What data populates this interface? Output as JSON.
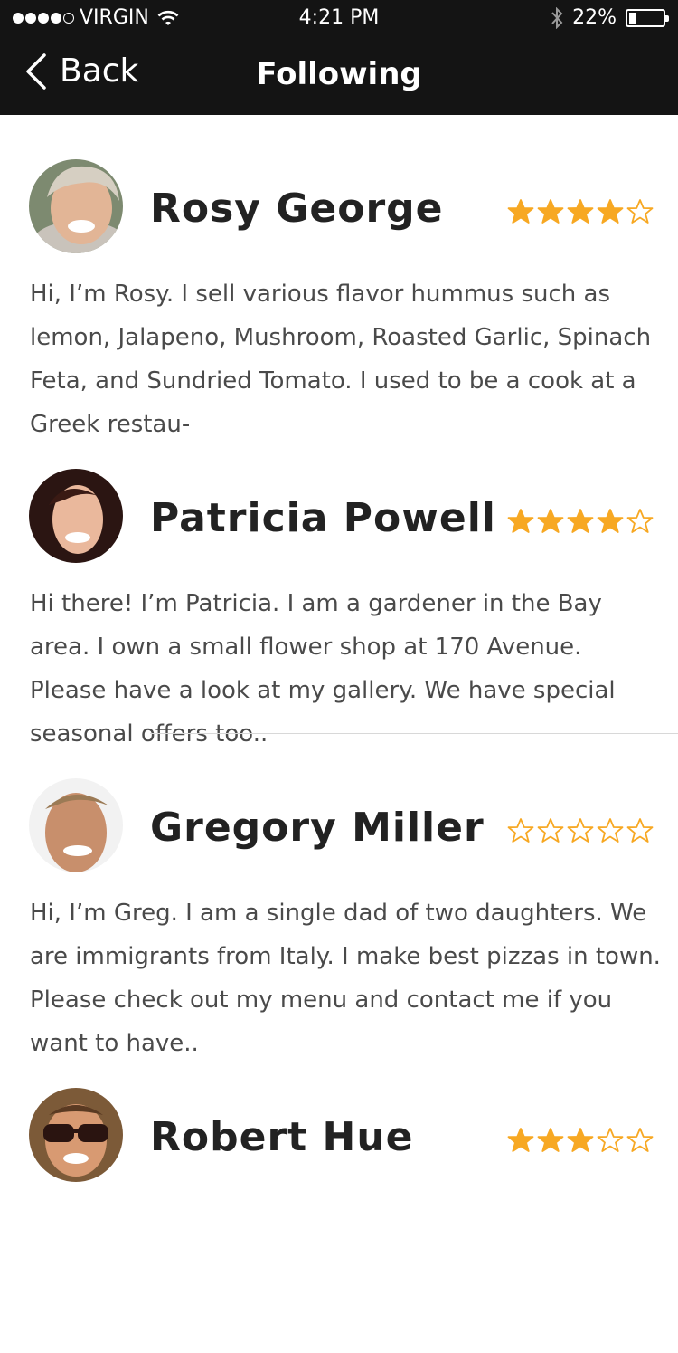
{
  "status_bar": {
    "carrier": "VIRGIN",
    "time": "4:21 PM",
    "battery": "22%",
    "signal_bars": 4,
    "battery_level": 0.22
  },
  "nav": {
    "back_label": "Back",
    "title": "Following"
  },
  "colors": {
    "bar": "#141414",
    "star": "#f7a823",
    "text": "#2b2b2b",
    "divider": "#d8d8d8"
  },
  "users": [
    {
      "name": "Rosy George",
      "rating": 4,
      "bio": "Hi, I’m Rosy. I sell various flavor hummus such as lemon, Jalapeno, Mushroom, Roasted Garlic, Spinach Feta, and Sundried Tomato. I used to be a cook at a Greek restau-"
    },
    {
      "name": "Patricia Powell",
      "rating": 4,
      "bio": "Hi there! I’m Patricia. I am a gardener in the Bay area. I own a small flower shop at 170 Avenue. Please have a look at my gallery. We have special seasonal offers too.."
    },
    {
      "name": "Gregory Miller",
      "rating": 0,
      "bio": "Hi, I’m Greg. I am a single dad of two daughters. We are immigrants from Italy. I make best pizzas in town. Please check out my menu and contact me if you want to have.."
    },
    {
      "name": "Robert Hue",
      "rating": 3,
      "bio": ""
    }
  ]
}
